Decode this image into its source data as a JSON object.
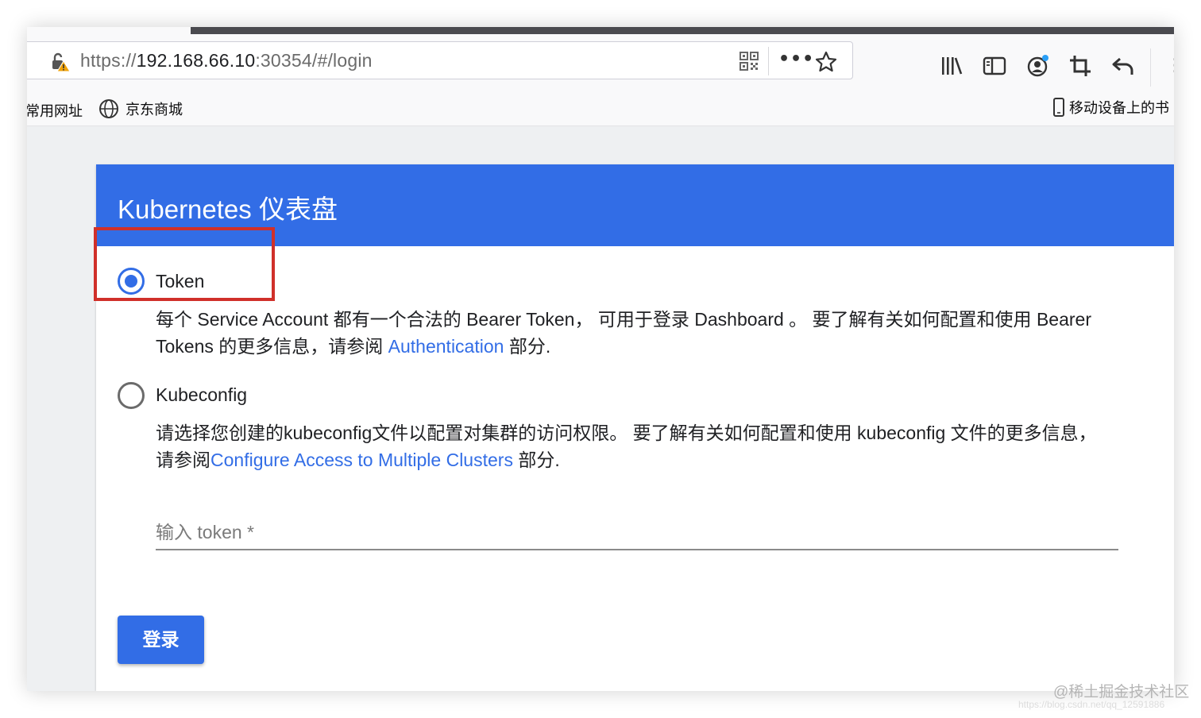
{
  "browser": {
    "url_scheme": "https://",
    "url_host": "192.168.66.10",
    "url_rest": ":30354/#/login",
    "more_label": "•••",
    "menu_label": "⋮"
  },
  "bookmarks": {
    "item1": "常用网址",
    "item2": "京东商城",
    "mobile": "移动设备上的书"
  },
  "app": {
    "title": "Kubernetes 仪表盘",
    "token_label": "Token",
    "token_desc_pre": "每个 Service Account 都有一个合法的 Bearer Token， 可用于登录 Dashboard 。 要了解有关如何配置和使用 Bearer Tokens 的更多信息，请参阅 ",
    "token_desc_link": "Authentication",
    "token_desc_post": " 部分.",
    "kubeconfig_label": "Kubeconfig",
    "kubeconfig_desc_pre": "请选择您创建的kubeconfig文件以配置对集群的访问权限。 要了解有关如何配置和使用 kubeconfig 文件的更多信息， 请参阅",
    "kubeconfig_desc_link": "Configure Access to Multiple Clusters",
    "kubeconfig_desc_post": " 部分.",
    "token_placeholder": "输入 token *",
    "login_button": "登录"
  },
  "watermark": {
    "line1": "@稀土掘金技术社区",
    "line2": "https://blog.csdn.net/qq_12591886"
  },
  "colors": {
    "accent": "#326de6",
    "highlight": "#d0302a"
  }
}
